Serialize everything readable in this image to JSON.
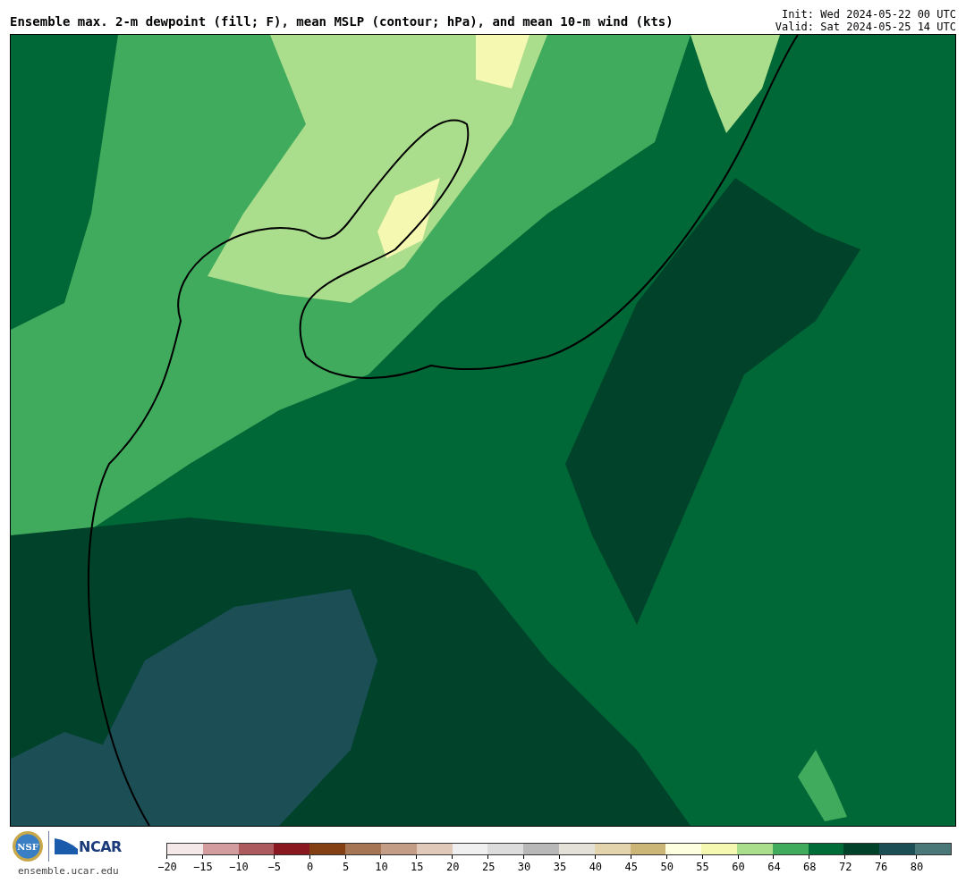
{
  "title": "Ensemble max. 2-m dewpoint (fill; F), mean MSLP (contour; hPa), and mean 10-m wind (kts)",
  "init": "Init: Wed 2024-05-22 00 UTC",
  "valid": "Valid: Sat 2024-05-25 14 UTC",
  "logos": {
    "nsf": "NSF",
    "ncar": "NCAR"
  },
  "site": "ensemble.ucar.edu",
  "colorbar": {
    "bins": [
      {
        "label": "−20",
        "color": "#f4e8e8"
      },
      {
        "label": "−15",
        "color": "#d39da0"
      },
      {
        "label": "−10",
        "color": "#ad5a5f"
      },
      {
        "label": "−5",
        "color": "#8a1820"
      },
      {
        "label": "0",
        "color": "#843f12"
      },
      {
        "label": "5",
        "color": "#a67554"
      },
      {
        "label": "10",
        "color": "#c39d85"
      },
      {
        "label": "15",
        "color": "#e0c9b8"
      },
      {
        "label": "20",
        "color": "#f0f0f0"
      },
      {
        "label": "25",
        "color": "#dcdcdc"
      },
      {
        "label": "30",
        "color": "#b8b8b8"
      },
      {
        "label": "35",
        "color": "#e4e2d8"
      },
      {
        "label": "40",
        "color": "#e3d4ae"
      },
      {
        "label": "45",
        "color": "#cbb677"
      },
      {
        "label": "50",
        "color": "#fefee0"
      },
      {
        "label": "55",
        "color": "#f5f8b0"
      },
      {
        "label": "60",
        "color": "#aadd8c"
      },
      {
        "label": "64",
        "color": "#41ab5d"
      },
      {
        "label": "68",
        "color": "#006d39"
      },
      {
        "label": "72",
        "color": "#00432a"
      },
      {
        "label": "76",
        "color": "#1b4e55"
      },
      {
        "label": "80",
        "color": "#4a7879"
      }
    ]
  }
}
